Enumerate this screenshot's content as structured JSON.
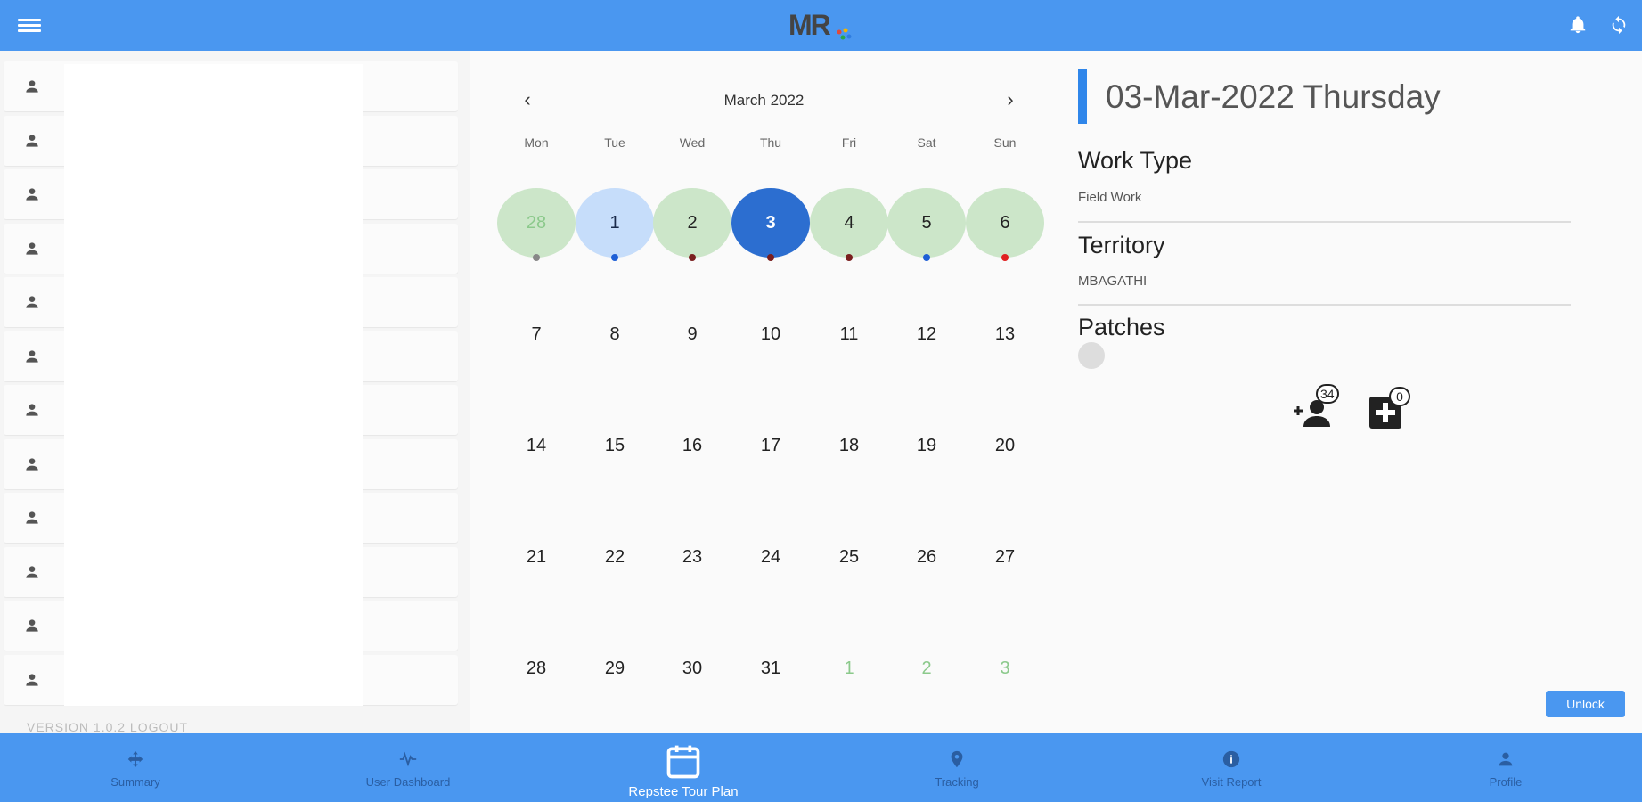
{
  "app": {
    "logo": "MR",
    "colors": {
      "primary": "#4a97f0",
      "accent": "#2f86ea",
      "green_day": "#cce6c9",
      "planned_day": "#c6ddfa",
      "selected_day": "#2c6ed0"
    },
    "icons": {
      "menu": "menu-icon",
      "notifications": "bell-icon",
      "sync": "sync-icon"
    }
  },
  "left_panel": {
    "rows": 12,
    "row_icon": "person-icon",
    "footer_text": "VERSION 1.0.2 LOGOUT"
  },
  "calendar": {
    "month_label": "March 2022",
    "weekdays": [
      "Mon",
      "Tue",
      "Wed",
      "Thu",
      "Fri",
      "Sat",
      "Sun"
    ],
    "weeks": [
      [
        {
          "d": "28",
          "state": "green-muted",
          "dot": "#888888"
        },
        {
          "d": "1",
          "state": "planned",
          "dot": "#1e5fd6"
        },
        {
          "d": "2",
          "state": "green",
          "dot": "#7a1f1f"
        },
        {
          "d": "3",
          "state": "selected",
          "dot": "#7a1f1f"
        },
        {
          "d": "4",
          "state": "green",
          "dot": "#7a1f1f"
        },
        {
          "d": "5",
          "state": "green",
          "dot": "#1e5fd6"
        },
        {
          "d": "6",
          "state": "green",
          "dot": "#e02020"
        }
      ],
      [
        {
          "d": "7"
        },
        {
          "d": "8"
        },
        {
          "d": "9"
        },
        {
          "d": "10"
        },
        {
          "d": "11"
        },
        {
          "d": "12"
        },
        {
          "d": "13"
        }
      ],
      [
        {
          "d": "14"
        },
        {
          "d": "15"
        },
        {
          "d": "16"
        },
        {
          "d": "17"
        },
        {
          "d": "18"
        },
        {
          "d": "19"
        },
        {
          "d": "20"
        }
      ],
      [
        {
          "d": "21"
        },
        {
          "d": "22"
        },
        {
          "d": "23"
        },
        {
          "d": "24"
        },
        {
          "d": "25"
        },
        {
          "d": "26"
        },
        {
          "d": "27"
        }
      ],
      [
        {
          "d": "28"
        },
        {
          "d": "29"
        },
        {
          "d": "30"
        },
        {
          "d": "31"
        },
        {
          "d": "1",
          "state": "next-month"
        },
        {
          "d": "2",
          "state": "next-month"
        },
        {
          "d": "3",
          "state": "next-month"
        }
      ]
    ]
  },
  "detail": {
    "date_title": "03-Mar-2022 Thursday",
    "work_type_label": "Work Type",
    "work_type_value": "Field Work",
    "territory_label": "Territory",
    "territory_value": "MBAGATHI",
    "patches_label": "Patches",
    "doctor_count": "34",
    "chemist_count": "0",
    "unlock_label": "Unlock"
  },
  "bottom_nav": [
    {
      "label": "Summary",
      "icon": "summary-icon",
      "active": false
    },
    {
      "label": "User Dashboard",
      "icon": "dashboard-icon",
      "active": false
    },
    {
      "label": "Repstee Tour Plan",
      "icon": "calendar-icon",
      "active": true
    },
    {
      "label": "Tracking",
      "icon": "location-pin-icon",
      "active": false
    },
    {
      "label": "Visit Report",
      "icon": "info-icon",
      "active": false
    },
    {
      "label": "Profile",
      "icon": "person-icon",
      "active": false
    }
  ]
}
